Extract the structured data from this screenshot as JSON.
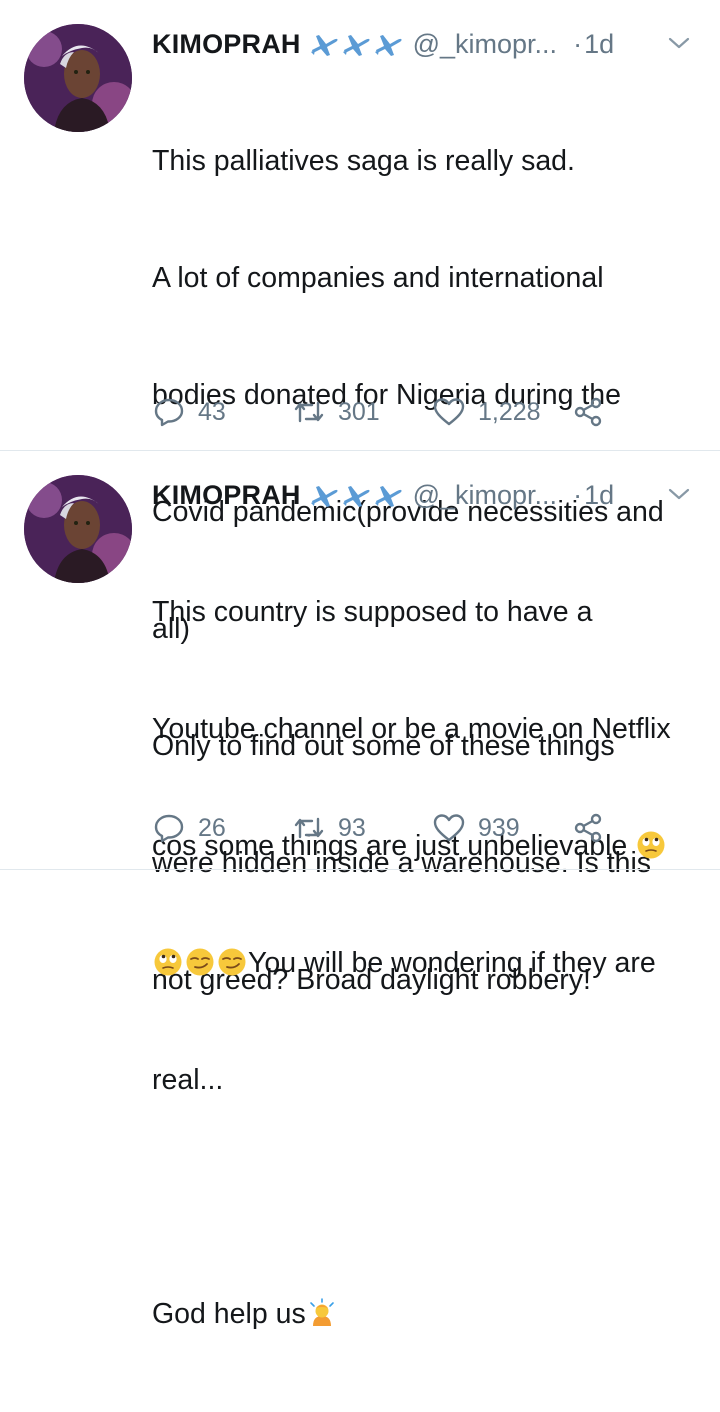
{
  "tweets": [
    {
      "name": "KIMOPRAH",
      "handle": "@_kimopr...",
      "dot": "·",
      "time": "1d",
      "text_lines": [
        "This palliatives saga is really sad.",
        "A lot of companies and international",
        "bodies donated for Nigeria during the",
        "Covid pandemic(provide necessities and",
        "all)",
        "Only to find out some of these things",
        "were hidden inside a warehouse. Is this",
        "not greed? Broad daylight robbery!"
      ],
      "replies": "43",
      "retweets": "301",
      "likes": "1,228"
    },
    {
      "name": "KIMOPRAH",
      "handle": "@_kimopr...",
      "dot": "·",
      "time": "1d",
      "text_lines": [
        "This country is supposed to have a",
        "Youtube channel or be a movie on Netflix",
        "cos some things are just unbelievable",
        "You will be wondering if they are",
        "real...",
        "",
        "God help us"
      ],
      "replies": "26",
      "retweets": "93",
      "likes": "939"
    }
  ],
  "icons": {
    "name_decoration": [
      "airplane-icon",
      "airplane-icon",
      "airplane-icon"
    ],
    "menu": "chevron-down-icon",
    "reply": "reply-icon",
    "retweet": "retweet-icon",
    "like": "heart-icon",
    "share": "share-icon",
    "emojis_tweet2": [
      "face-with-rolling-eyes",
      "face-with-rolling-eyes",
      "smirking-face",
      "smirking-face",
      "person-bowing"
    ]
  },
  "colors": {
    "text": "#14171a",
    "secondary": "#657786",
    "plane": "#5b9bd5",
    "divider": "#e1e8ed"
  }
}
